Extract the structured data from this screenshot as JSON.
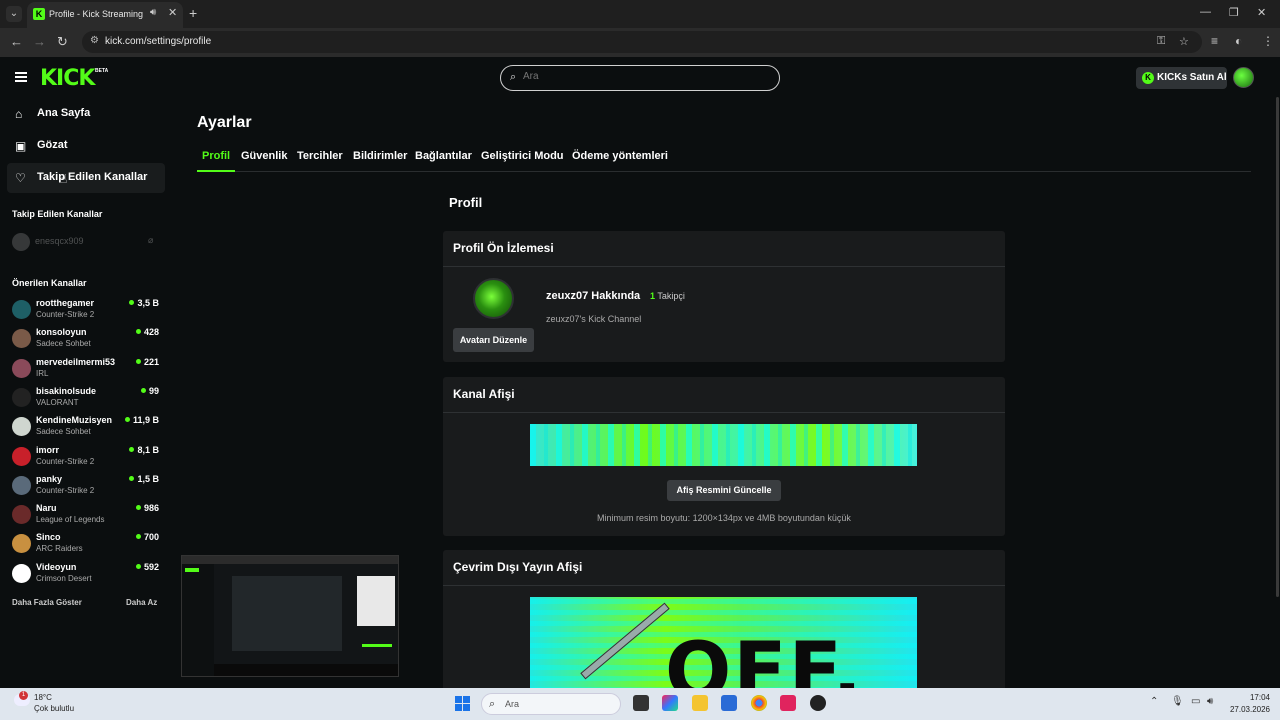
{
  "browser": {
    "tab_title": "Profile - Kick Streaming",
    "url": "kick.com/settings/profile"
  },
  "header": {
    "logo": "KICK",
    "logo_badge": "BETA",
    "search_placeholder": "Ara",
    "kicks_button": "KICKs Satın Al"
  },
  "sidebar": {
    "nav": [
      {
        "label": "Ana Sayfa",
        "icon": "home-icon"
      },
      {
        "label": "Gözat",
        "icon": "browse-icon"
      },
      {
        "label": "Takip Edilen Kanallar",
        "icon": "heart-icon"
      }
    ],
    "followed_heading": "Takip Edilen Kanallar",
    "followed": [
      {
        "name": "enesqcx909"
      }
    ],
    "recommended_heading": "Önerilen Kanallar",
    "recommended": [
      {
        "name": "rootthegamer",
        "category": "Counter-Strike 2",
        "viewers": "3,5 B",
        "color": "#1e5f66"
      },
      {
        "name": "konsoloyun",
        "category": "Sadece Sohbet",
        "viewers": "428",
        "color": "#7a5a48"
      },
      {
        "name": "mervedeilmermi53",
        "category": "IRL",
        "viewers": "221",
        "color": "#8a4a5a"
      },
      {
        "name": "bisakinolsude",
        "category": "VALORANT",
        "viewers": "99",
        "color": "#222222"
      },
      {
        "name": "KendineMuzisyen",
        "category": "Sadece Sohbet",
        "viewers": "11,9 B",
        "color": "#cfd6cf"
      },
      {
        "name": "imorr",
        "category": "Counter-Strike 2",
        "viewers": "8,1 B",
        "color": "#c8202a"
      },
      {
        "name": "panky",
        "category": "Counter-Strike 2",
        "viewers": "1,5 B",
        "color": "#5a6a7a"
      },
      {
        "name": "Naru",
        "category": "League of Legends",
        "viewers": "986",
        "color": "#6a2a2a"
      },
      {
        "name": "Sinco",
        "category": "ARC Raiders",
        "viewers": "700",
        "color": "#c89040"
      },
      {
        "name": "Videoyun",
        "category": "Crimson Desert",
        "viewers": "592",
        "color": "#ffffff"
      }
    ],
    "show_more": "Daha Fazla Göster",
    "show_less": "Daha Az"
  },
  "settings": {
    "title": "Ayarlar",
    "tabs": [
      "Profil",
      "Güvenlik",
      "Tercihler",
      "Bildirimler",
      "Bağlantılar",
      "Geliştirici Modu",
      "Ödeme yöntemleri"
    ],
    "section_title": "Profil",
    "preview": {
      "heading": "Profil Ön İzlemesi",
      "edit_avatar": "Avatarı Düzenle",
      "about_name": "zeuxz07 Hakkında",
      "followers_count": "1",
      "followers_label": "Takipçi",
      "description": "zeuxz07's Kick Channel"
    },
    "banner": {
      "heading": "Kanal Afişi",
      "update_button": "Afiş Resmini Güncelle",
      "hint": "Minimum resim boyutu: 1200×134px ve 4MB boyutundan küçük"
    },
    "offline_banner": {
      "heading": "Çevrim Dışı Yayın Afişi",
      "image_text": "OFF."
    }
  },
  "taskbar": {
    "temperature": "18°C",
    "weather": "Çok bulutlu",
    "weather_badge": "1",
    "search": "Ara",
    "time": "17:04",
    "date": "27.03.2026"
  }
}
